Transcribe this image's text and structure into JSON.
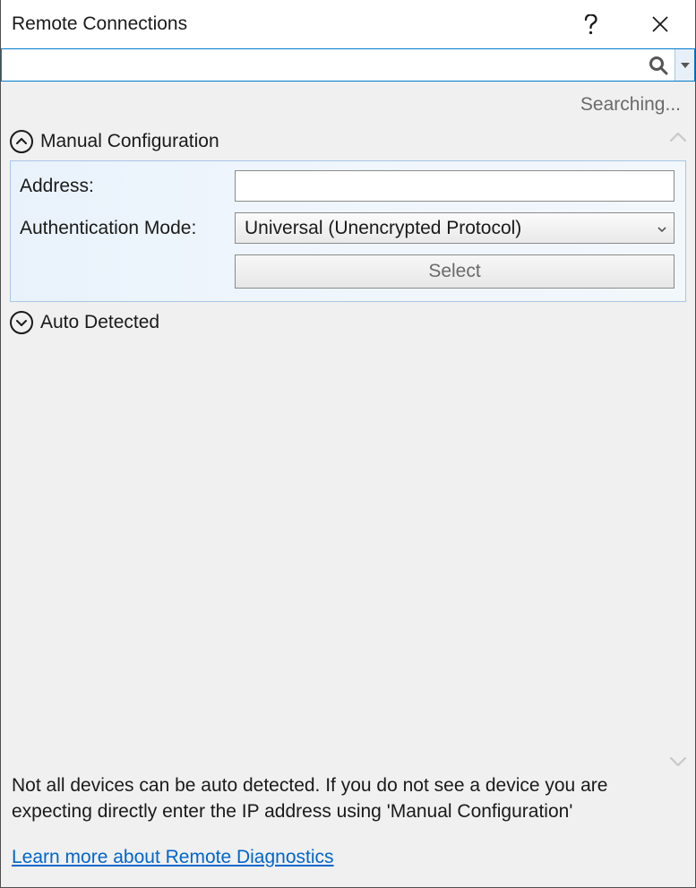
{
  "titlebar": {
    "title": "Remote Connections"
  },
  "search": {
    "value": "",
    "placeholder": ""
  },
  "status": {
    "text": "Searching..."
  },
  "sections": {
    "manual": {
      "title": "Manual Configuration",
      "fields": {
        "address_label": "Address:",
        "address_value": "",
        "auth_label": "Authentication Mode:",
        "auth_value": "Universal (Unencrypted Protocol)",
        "select_button": "Select"
      }
    },
    "auto": {
      "title": "Auto Detected"
    }
  },
  "footer": {
    "note": "Not all devices can be auto detected. If you do not see a device you are expecting directly enter the IP address using 'Manual Configuration'",
    "link": "Learn more about Remote Diagnostics"
  }
}
